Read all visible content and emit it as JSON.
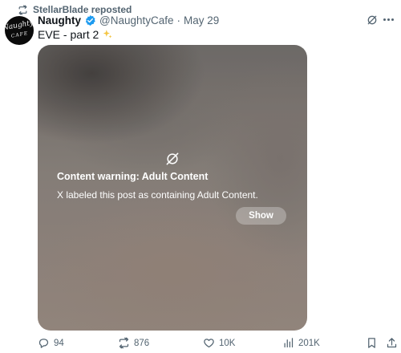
{
  "repost": {
    "label": "StellarBlade reposted",
    "icon": "repost-icon"
  },
  "author": {
    "avatar_text": "Naughty",
    "avatar_subtext": "CAFE",
    "name": "Naughty",
    "handle": "@NaughtyCafe",
    "separator": "·",
    "date": "May 29",
    "verified": true,
    "verified_color": "#1d9bf0"
  },
  "tweet": {
    "text": "EVE - part 2",
    "emoji": "sparkles-icon"
  },
  "media": {
    "warning_icon": "eye-slash-icon",
    "warning_title": "Content warning: Adult Content",
    "warning_body": "X labeled this post as containing Adult Content.",
    "show_label": "Show"
  },
  "actions": {
    "replies": "94",
    "reposts": "876",
    "likes": "10K",
    "views": "201K"
  },
  "colors": {
    "secondary_text": "#536471",
    "primary_text": "#0f1419",
    "accent": "#1d9bf0",
    "sparkle": "#f4c542"
  }
}
